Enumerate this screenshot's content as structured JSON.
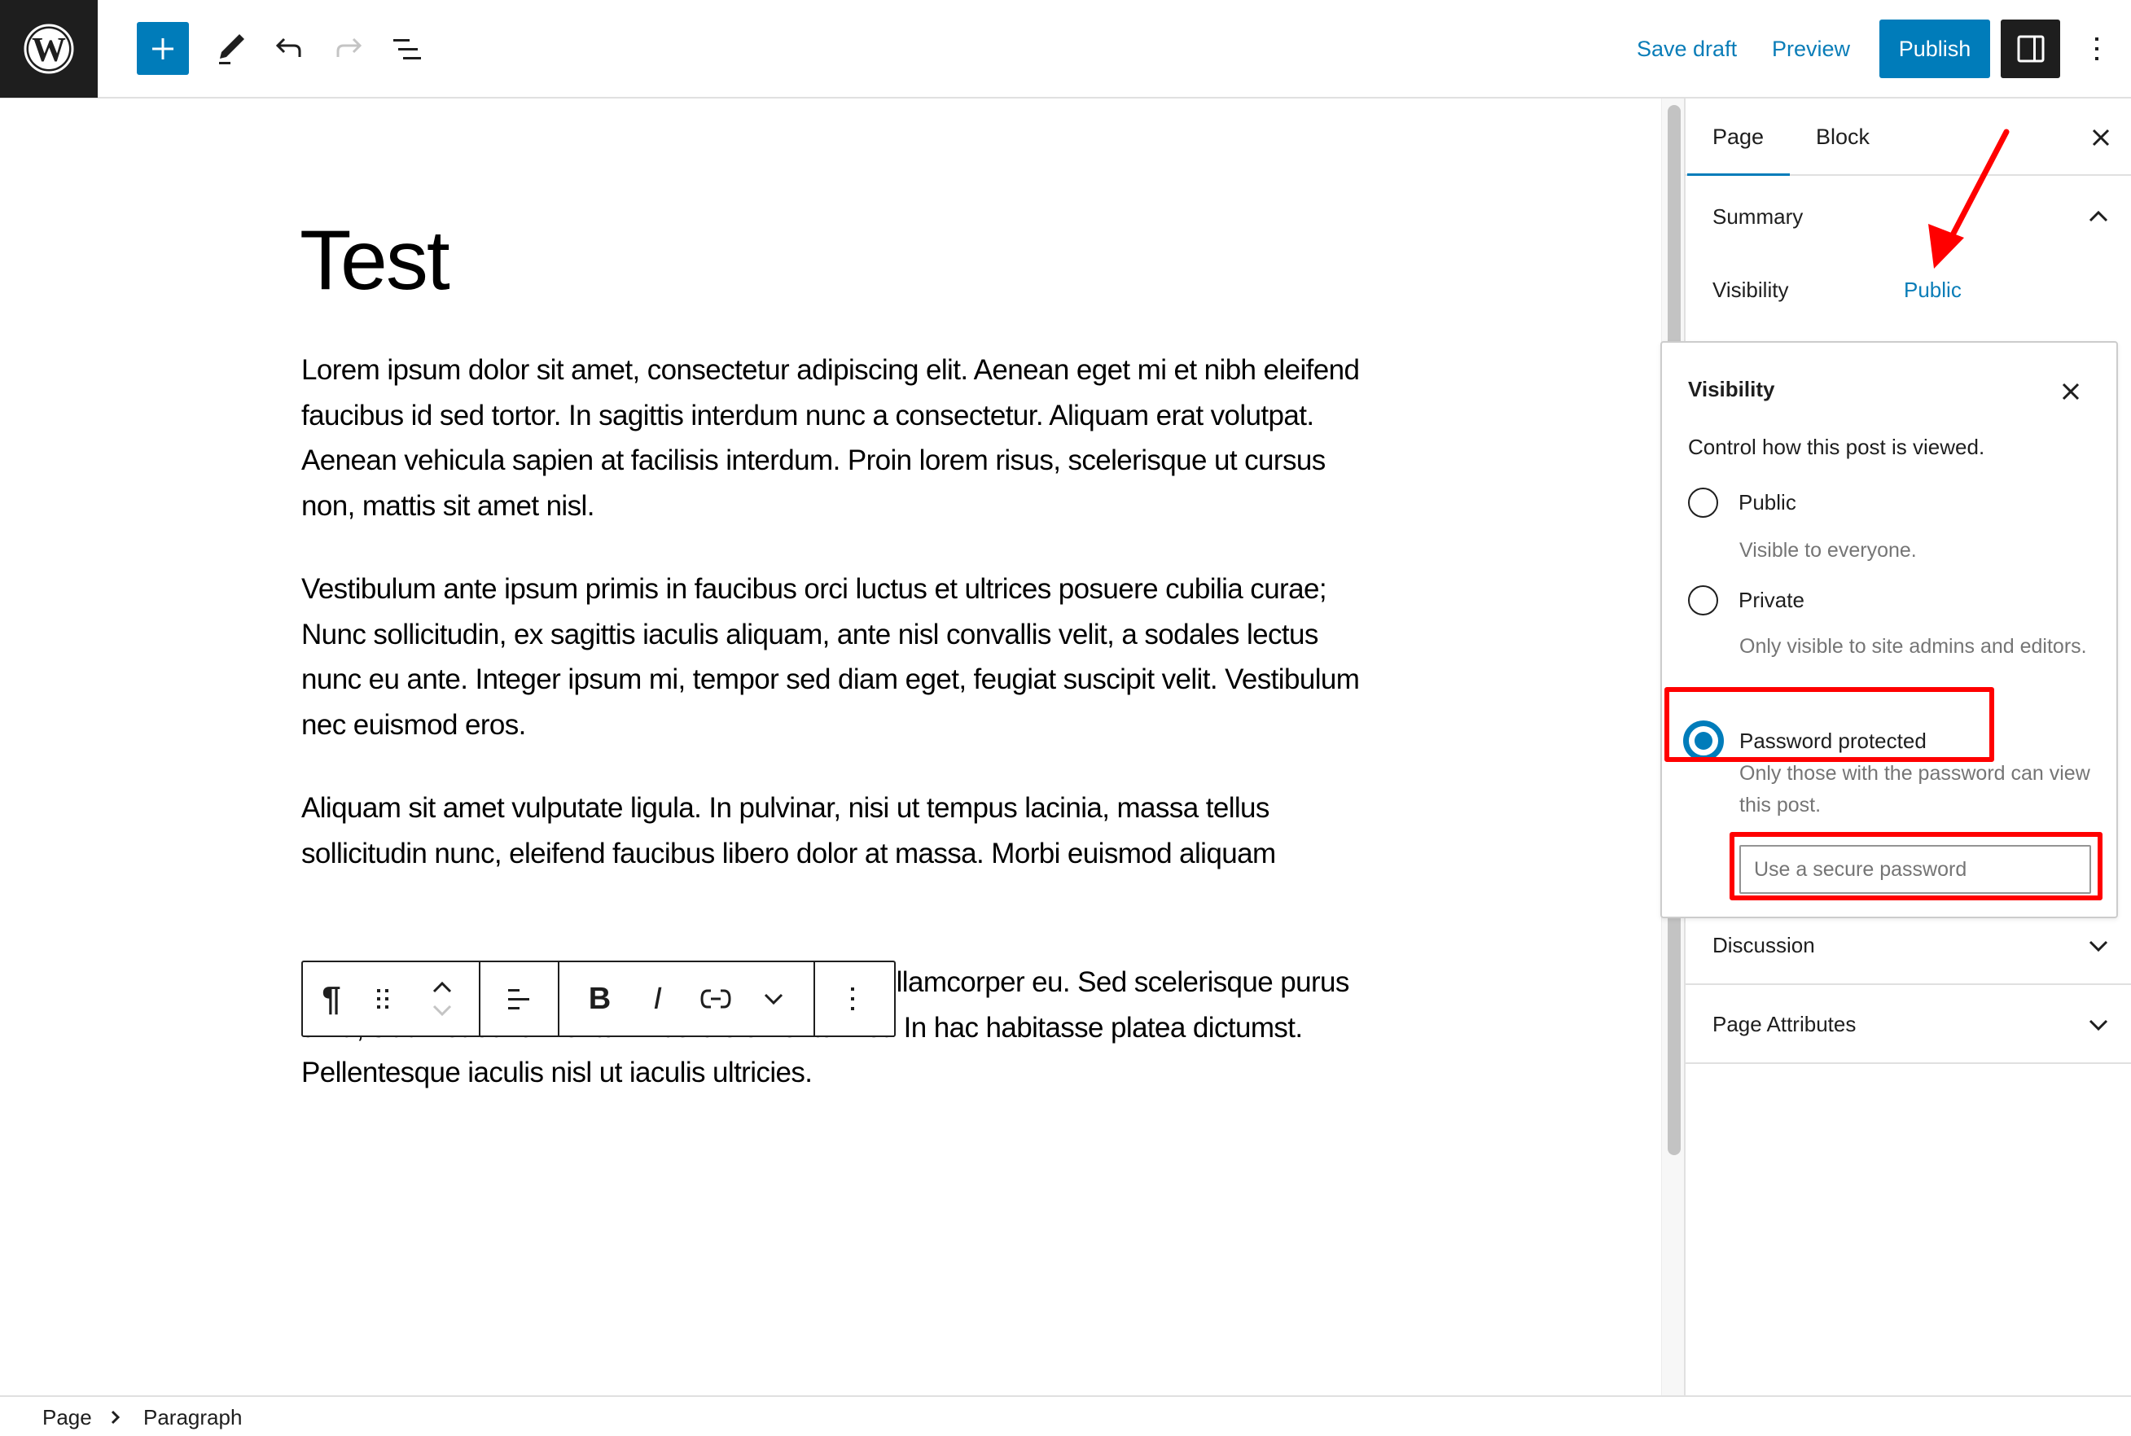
{
  "topbar": {
    "logo": "wordpress-logo",
    "tools": [
      {
        "name": "add-block",
        "icon": "plus-icon"
      },
      {
        "name": "tools",
        "icon": "pencil-icon"
      },
      {
        "name": "undo",
        "icon": "undo-icon"
      },
      {
        "name": "redo",
        "icon": "redo-icon"
      },
      {
        "name": "document-overview",
        "icon": "list-view-icon"
      }
    ],
    "save_draft_label": "Save draft",
    "preview_label": "Preview",
    "publish_label": "Publish"
  },
  "editor": {
    "title": "Test",
    "paragraphs": [
      "Lorem ipsum dolor sit amet, consectetur adipiscing elit. Aenean eget mi et nibh eleifend faucibus id sed tortor. In sagittis interdum nunc a consectetur. Aliquam erat volutpat. Aenean vehicula sapien at facilisis interdum. Proin lorem risus, scelerisque ut cursus non, mattis sit amet nisl.",
      "Vestibulum ante ipsum primis in faucibus orci luctus et ultrices posuere cubilia curae; Nunc sollicitudin, ex sagittis iaculis aliquam, ante nisl convallis velit, a sodales lectus nunc eu ante. Integer ipsum mi, tempor sed diam eget, feugiat suscipit velit. Vestibulum nec euismod eros.",
      "Aliquam sit amet vulputate ligula. In pulvinar, nisi ut tempus lacinia, massa tellus sollicitudin nunc, eleifend faucibus libero dolor at massa. Morbi euismod aliquam",
      "Praesent pretium leo orci, vitae ullamcorper leo ullamcorper eu. Sed scelerisque purus urna, sit amet condimentum libero elementum et. In hac habitasse platea dictumst. Pellentesque iaculis nisl ut iaculis ultricies."
    ],
    "block_toolbar": {
      "groups": [
        [
          "paragraph-icon",
          "drag-handle-icon",
          "move-up-down-icon"
        ],
        [
          "align-left-icon"
        ],
        [
          "bold-icon",
          "italic-icon",
          "link-icon",
          "more-chevron-icon"
        ],
        [
          "options-kebab-icon"
        ]
      ],
      "bold": "B",
      "italic": "I",
      "paragraph": "¶"
    }
  },
  "sidebar": {
    "tabs": [
      {
        "label": "Page",
        "active": true
      },
      {
        "label": "Block",
        "active": false
      }
    ],
    "summary": {
      "title": "Summary",
      "expanded": true,
      "visibility_label": "Visibility",
      "visibility_value": "Public"
    },
    "panels": [
      {
        "title": "Discussion",
        "expanded": false
      },
      {
        "title": "Page Attributes",
        "expanded": false
      }
    ]
  },
  "visibility_popover": {
    "title": "Visibility",
    "description": "Control how this post is viewed.",
    "options": [
      {
        "label": "Public",
        "help": "Visible to everyone.",
        "checked": false
      },
      {
        "label": "Private",
        "help": "Only visible to site admins and editors.",
        "checked": false
      },
      {
        "label": "Password protected",
        "help": "Only those with the password can view this post.",
        "checked": true
      }
    ],
    "password_placeholder": "Use a secure password",
    "password_value": ""
  },
  "breadcrumb": {
    "items": [
      "Page",
      "Paragraph"
    ]
  },
  "colors": {
    "accent": "#007cba",
    "dark": "#1e1e1e",
    "annotation": "#ff0000",
    "spellcheck": "#d63638",
    "help_text": "#757575"
  }
}
